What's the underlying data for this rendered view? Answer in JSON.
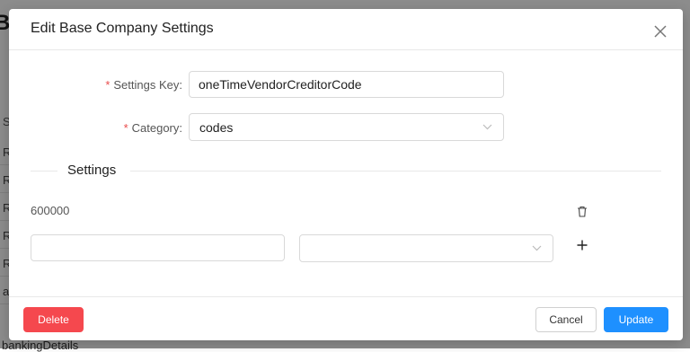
{
  "background": {
    "title_fragment": "Ba",
    "column_header": "S",
    "row_fragments": [
      "R",
      "R",
      "R",
      "R",
      "R",
      "a"
    ],
    "bottom_text": "bankingDetails"
  },
  "modal": {
    "title": "Edit Base Company Settings",
    "close_icon": "close-icon",
    "form": {
      "settings_key": {
        "label": "Settings Key",
        "required_mark": "*",
        "value": "oneTimeVendorCreditorCode"
      },
      "category": {
        "label": "Category",
        "required_mark": "*",
        "value": "codes",
        "icon": "chevron-down-icon"
      }
    },
    "settings_section": {
      "title": "Settings",
      "existing_items": [
        {
          "value": "600000",
          "delete_icon": "trash-icon"
        }
      ],
      "new_item": {
        "text_value": "",
        "select_value": "",
        "select_icon": "chevron-down-icon",
        "add_icon": "plus-icon"
      }
    },
    "footer": {
      "delete_label": "Delete",
      "cancel_label": "Cancel",
      "update_label": "Update"
    }
  },
  "colors": {
    "primary": "#1e90ff",
    "danger": "#f5484e",
    "required": "#e94b4b"
  }
}
